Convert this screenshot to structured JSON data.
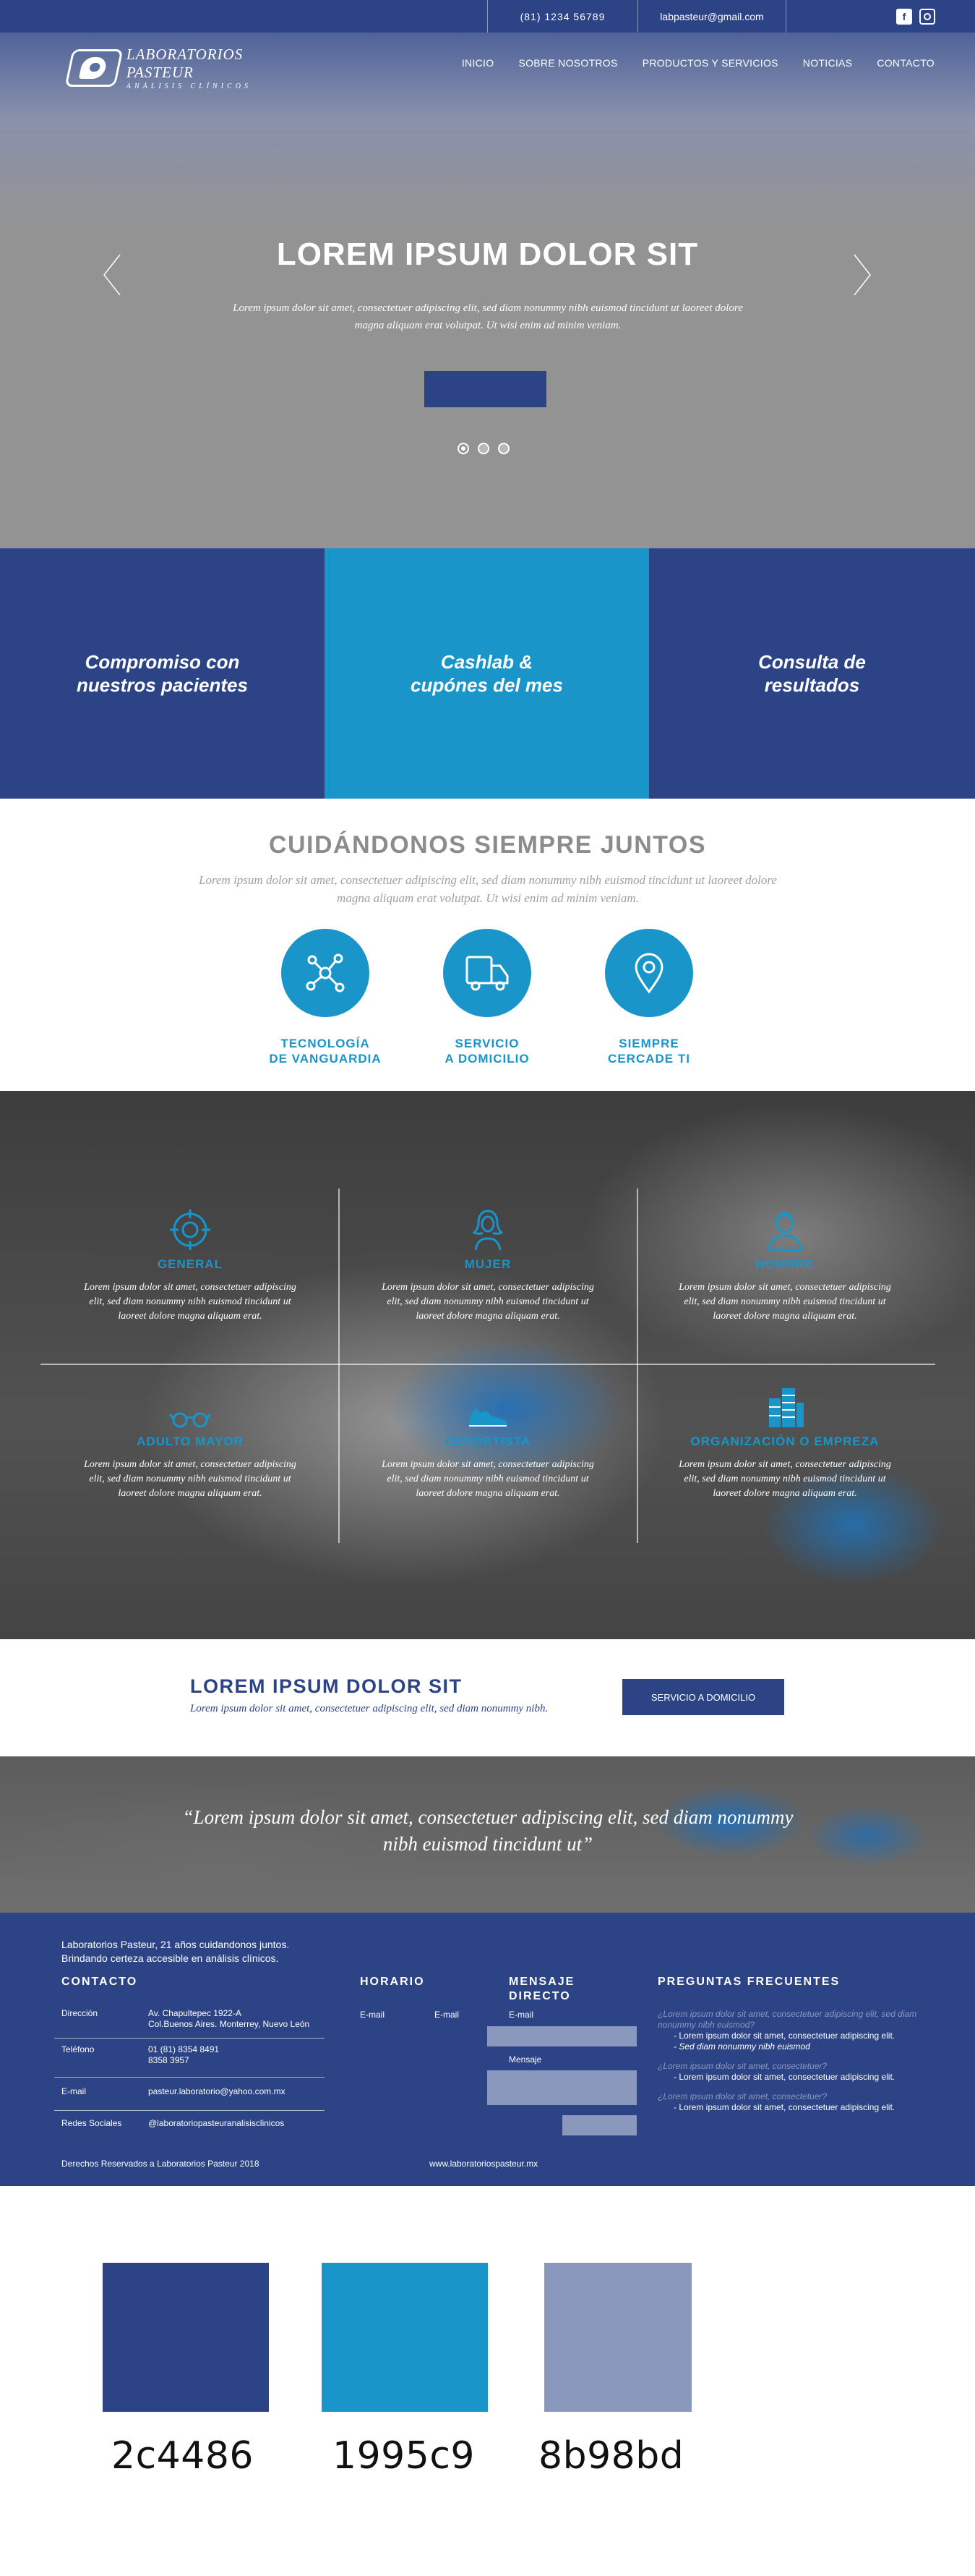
{
  "topbar": {
    "phone": "(81)  1234  56789",
    "email": "labpasteur@gmail.com",
    "social": [
      {
        "icon": "facebook-icon",
        "glyph": "f"
      },
      {
        "icon": "instagram-icon"
      }
    ]
  },
  "brand": {
    "name": "LABORATORIOS PASTEUR",
    "tagline": "ANÁLISIS CLÍNICOS"
  },
  "nav": {
    "items": [
      "INICIO",
      "SOBRE NOSOTROS",
      "PRODUCTOS Y SERVICIOS",
      "NOTICIAS",
      "CONTACTO"
    ]
  },
  "hero": {
    "title": "LOREM IPSUM DOLOR SIT",
    "subtitle": "Lorem ipsum dolor sit amet, consectetuer adipiscing elit, sed diam nonummy nibh euismod tincidunt ut laoreet dolore magna aliquam erat volutpat. Ut wisi enim ad minim veniam.",
    "slide_count": 3,
    "active_slide": 1
  },
  "features": [
    "Compromiso con\nnuestros pacientes",
    "Cashlab &\ncupónes del mes",
    "Consulta de\nresultados"
  ],
  "care": {
    "title": "CUIDÁNDONOS SIEMPRE JUNTOS",
    "lead": "Lorem ipsum dolor sit amet, consectetuer adipiscing elit, sed diam nonummy nibh euismod tincidunt ut laoreet dolore magna aliquam erat volutpat. Ut wisi enim ad minim veniam.",
    "items": [
      {
        "icon": "network-icon",
        "label": "TECNOLOGÍA\nDE VANGUARDIA"
      },
      {
        "icon": "delivery-truck-icon",
        "label": "SERVICIO\nA DOMICILIO"
      },
      {
        "icon": "location-pin-icon",
        "label": "SIEMPRE\nCERCADE TI"
      }
    ]
  },
  "services": [
    {
      "icon": "target-icon",
      "name": "GENERAL",
      "text": "Lorem ipsum dolor sit amet, consectetuer adipiscing elit, sed diam nonummy nibh euismod tincidunt ut laoreet dolore magna aliquam erat."
    },
    {
      "icon": "woman-icon",
      "name": "MUJER",
      "text": "Lorem ipsum dolor sit amet, consectetuer adipiscing elit, sed diam nonummy nibh euismod tincidunt ut laoreet dolore magna aliquam erat."
    },
    {
      "icon": "man-icon",
      "name": "HOMBRE",
      "text": "Lorem ipsum dolor sit amet, consectetuer adipiscing elit, sed diam nonummy nibh euismod tincidunt ut laoreet dolore magna aliquam erat."
    },
    {
      "icon": "glasses-icon",
      "name": "ADULTO MAYOR",
      "text": "Lorem ipsum dolor sit amet, consectetuer adipiscing elit, sed diam nonummy nibh euismod tincidunt ut laoreet dolore magna aliquam erat."
    },
    {
      "icon": "sneaker-icon",
      "name": "DEPORTISTA",
      "text": "Lorem ipsum dolor sit amet, consectetuer adipiscing elit, sed diam nonummy nibh euismod tincidunt ut laoreet dolore magna aliquam erat."
    },
    {
      "icon": "building-icon",
      "name": "ORGANIZACIÓN O EMPREZA",
      "text": "Lorem ipsum dolor sit amet, consectetuer adipiscing elit, sed diam nonummy nibh euismod tincidunt ut laoreet dolore magna aliquam erat."
    }
  ],
  "banner": {
    "title": "LOREM IPSUM DOLOR SIT",
    "subtitle": "Lorem ipsum dolor sit amet, consectetuer adipiscing elit, sed diam nonummy nibh.",
    "button": "SERVICIO A DOMICILIO"
  },
  "quote": {
    "text": "“Lorem ipsum dolor sit amet, consectetuer adipiscing elit, sed diam nonummy nibh euismod tincidunt ut”"
  },
  "footer": {
    "intro": "Laboratorios Pasteur, 21 años cuidandonos juntos.\nBrindando certeza accesible en análisis clínicos.",
    "contact": {
      "title": "CONTACTO",
      "rows": [
        {
          "key": "Dirección",
          "value": "Av. Chapultepec 1922-A\nCol.Buenos Aires. Monterrey, Nuevo León"
        },
        {
          "key": "Teléfono",
          "value": "01 (81)  8354  8491\n           8358  3957"
        },
        {
          "key": "E-mail",
          "value": "pasteur.laboratorio@yahoo.com.mx"
        },
        {
          "key": "Redes Sociales",
          "value": "@laboratoriopasteuranalisisclinicos"
        }
      ]
    },
    "schedule": {
      "title": "HORARIO",
      "labels": [
        "E-mail",
        "E-mail"
      ]
    },
    "message": {
      "title": "MENSAJE\nDIRECTO",
      "email_label": "E-mail",
      "message_label": "Mensaje"
    },
    "faq": {
      "title": "PREGUNTAS FRECUENTES",
      "entries": [
        {
          "q": "¿Lorem ipsum dolor sit amet, consectetuer adipiscing elit, sed diam nonummy nibh euismod?",
          "answers": [
            "- Lorem ipsum dolor sit amet, consectetuer adipiscing elit.",
            "- Sed diam nonummy nibh euismod"
          ]
        },
        {
          "q": "¿Lorem ipsum dolor sit amet, consectetuer?",
          "answers": [
            "- Lorem ipsum dolor sit amet, consectetuer adipiscing elit."
          ]
        },
        {
          "q": "¿Lorem ipsum dolor sit amet, consectetuer?",
          "answers": [
            "- Lorem ipsum dolor sit amet, consectetuer adipiscing elit."
          ]
        }
      ]
    },
    "copyright": "Derechos Reservados a Laboratorios Pasteur   2018",
    "website": "www.laboratoriospasteur.mx"
  },
  "palette": [
    {
      "hex": "2c4486",
      "color": "#2c4486"
    },
    {
      "hex": "1995c9",
      "color": "#1995c9"
    },
    {
      "hex": "8b98bd",
      "color": "#8b98bd"
    }
  ]
}
